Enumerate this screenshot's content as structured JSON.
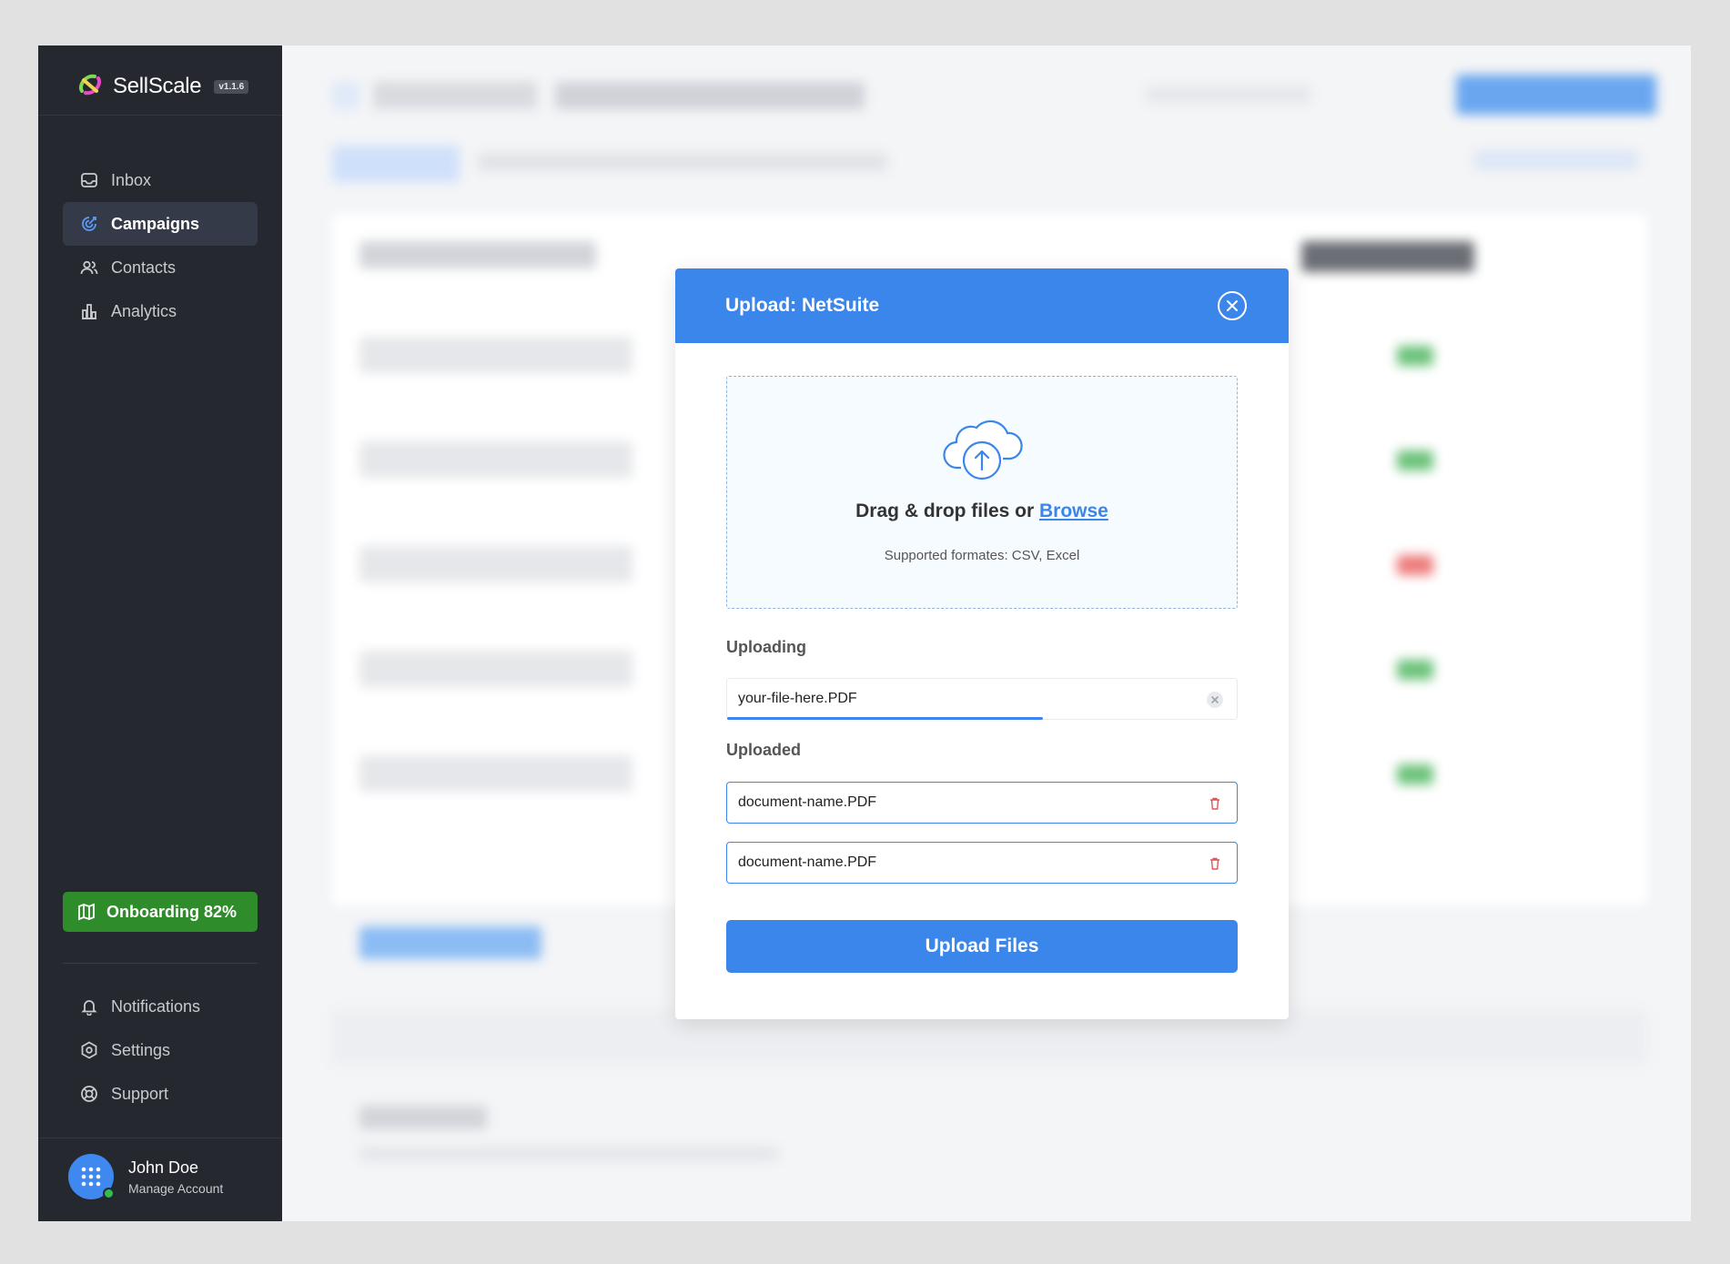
{
  "app": {
    "name": "SellScale",
    "version": "v1.1.6"
  },
  "sidebar": {
    "items": [
      {
        "label": "Inbox",
        "icon": "inbox-icon",
        "active": false
      },
      {
        "label": "Campaigns",
        "icon": "target-icon",
        "active": true
      },
      {
        "label": "Contacts",
        "icon": "users-icon",
        "active": false
      },
      {
        "label": "Analytics",
        "icon": "bar-chart-icon",
        "active": false
      }
    ],
    "onboarding": {
      "label": "Onboarding 82%",
      "progress": 0.82
    },
    "bottom_items": [
      {
        "label": "Notifications",
        "icon": "bell-icon"
      },
      {
        "label": "Settings",
        "icon": "gear-icon"
      },
      {
        "label": "Support",
        "icon": "lifebuoy-icon"
      }
    ],
    "user": {
      "name": "John Doe",
      "subtitle": "Manage Account",
      "status": "online"
    }
  },
  "modal": {
    "title": "Upload: NetSuite",
    "dropzone": {
      "text": "Drag & drop files or ",
      "browse": "Browse",
      "formats": "Supported formates: CSV, Excel"
    },
    "uploading_label": "Uploading",
    "uploading_file": {
      "name": "your-file-here.PDF",
      "progress": 0.62
    },
    "uploaded_label": "Uploaded",
    "uploaded_files": [
      {
        "name": "document-name.PDF"
      },
      {
        "name": "document-name.PDF"
      }
    ],
    "submit_label": "Upload Files"
  },
  "colors": {
    "accent": "#3b86eb",
    "sidebar_bg": "#25282e",
    "onboarding_bg": "#2f8c2a",
    "danger": "#e05555"
  }
}
